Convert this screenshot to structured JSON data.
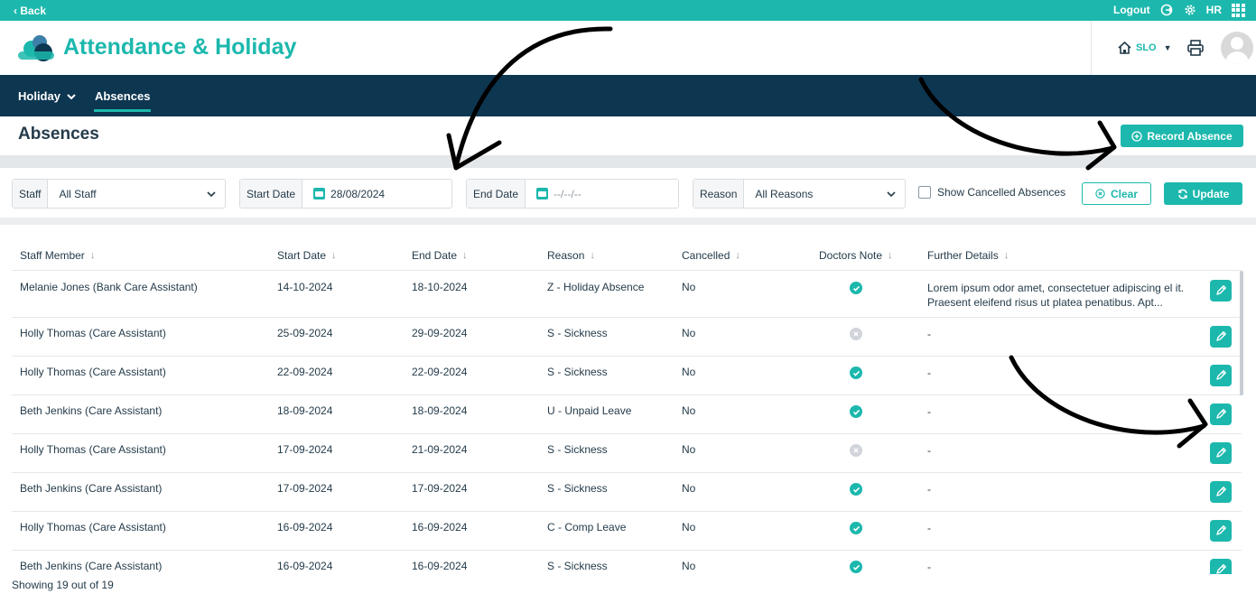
{
  "topbar": {
    "back_label": "Back",
    "logout_label": "Logout",
    "hr_label": "HR"
  },
  "header": {
    "app_title": "Attendance & Holiday",
    "site_label": "SLO"
  },
  "nav": {
    "items": [
      {
        "label": "Holiday"
      },
      {
        "label": "Absences"
      }
    ],
    "active": "Absences"
  },
  "page": {
    "title": "Absences",
    "record_button": "Record Absence"
  },
  "filters": {
    "staff_label": "Staff",
    "staff_value": "All Staff",
    "start_label": "Start Date",
    "start_value": "28/08/2024",
    "end_label": "End Date",
    "end_placeholder": "--/--/--",
    "reason_label": "Reason",
    "reason_value": "All Reasons",
    "show_cancelled_label": "Show Cancelled Absences",
    "clear_label": "Clear",
    "update_label": "Update"
  },
  "table": {
    "columns": [
      "Staff Member",
      "Start Date",
      "End Date",
      "Reason",
      "Cancelled",
      "Doctors Note",
      "Further Details"
    ],
    "rows": [
      {
        "staff": "Melanie Jones (Bank Care Assistant)",
        "start": "14-10-2024",
        "end": "18-10-2024",
        "reason": "Z - Holiday Absence",
        "cancelled": "No",
        "doctors_note": true,
        "details": "Lorem ipsum odor amet, consectetuer adipiscing el it. Praesent eleifend risus ut platea penatibus. Apt..."
      },
      {
        "staff": "Holly Thomas (Care Assistant)",
        "start": "25-09-2024",
        "end": "29-09-2024",
        "reason": "S - Sickness",
        "cancelled": "No",
        "doctors_note": false,
        "details": "-"
      },
      {
        "staff": "Holly Thomas (Care Assistant)",
        "start": "22-09-2024",
        "end": "22-09-2024",
        "reason": "S - Sickness",
        "cancelled": "No",
        "doctors_note": true,
        "details": "-"
      },
      {
        "staff": "Beth Jenkins (Care Assistant)",
        "start": "18-09-2024",
        "end": "18-09-2024",
        "reason": "U - Unpaid Leave",
        "cancelled": "No",
        "doctors_note": true,
        "details": "-"
      },
      {
        "staff": "Holly Thomas (Care Assistant)",
        "start": "17-09-2024",
        "end": "21-09-2024",
        "reason": "S - Sickness",
        "cancelled": "No",
        "doctors_note": false,
        "details": "-"
      },
      {
        "staff": "Beth Jenkins (Care Assistant)",
        "start": "17-09-2024",
        "end": "17-09-2024",
        "reason": "S - Sickness",
        "cancelled": "No",
        "doctors_note": true,
        "details": "-"
      },
      {
        "staff": "Holly Thomas (Care Assistant)",
        "start": "16-09-2024",
        "end": "16-09-2024",
        "reason": "C - Comp Leave",
        "cancelled": "No",
        "doctors_note": true,
        "details": "-"
      },
      {
        "staff": "Beth Jenkins (Care Assistant)",
        "start": "16-09-2024",
        "end": "16-09-2024",
        "reason": "S - Sickness",
        "cancelled": "No",
        "doctors_note": true,
        "details": "-"
      }
    ]
  },
  "footer": {
    "showing": "Showing 19 out of 19"
  },
  "colors": {
    "accent": "#1cb8ad",
    "nav_bg": "#0d3651",
    "text": "#243b4a"
  }
}
